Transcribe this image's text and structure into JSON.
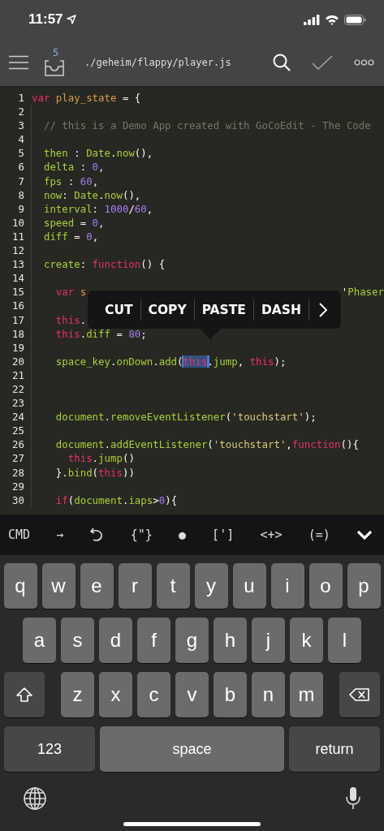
{
  "status_bar": {
    "time": "11:57"
  },
  "header": {
    "badge": "5",
    "path": "./geheim/flappy/player.js"
  },
  "code": {
    "lines": [
      {
        "n": "1",
        "tokens": [
          {
            "t": "var ",
            "kind": "kw"
          },
          {
            "t": "play_state",
            "kind": "name"
          },
          {
            "t": " = {",
            "kind": "punct"
          }
        ]
      },
      {
        "n": "2"
      },
      {
        "n": "3",
        "tokens": [
          {
            "t": "  // this is a Demo App created with GoCoEdit - The Code",
            "kind": "cmt"
          }
        ]
      },
      {
        "n": "4"
      },
      {
        "n": "5",
        "tokens": [
          {
            "t": "  then",
            "kind": "prop"
          },
          {
            "t": " : ",
            "kind": "punct"
          },
          {
            "t": "Date",
            "kind": "prop"
          },
          {
            "t": ".",
            "kind": "punct"
          },
          {
            "t": "now",
            "kind": "prop"
          },
          {
            "t": "(),",
            "kind": "punct"
          }
        ]
      },
      {
        "n": "6",
        "tokens": [
          {
            "t": "  delta",
            "kind": "prop"
          },
          {
            "t": " : ",
            "kind": "punct"
          },
          {
            "t": "0",
            "kind": "num"
          },
          {
            "t": ",",
            "kind": "punct"
          }
        ]
      },
      {
        "n": "7",
        "tokens": [
          {
            "t": "  fps",
            "kind": "prop"
          },
          {
            "t": " : ",
            "kind": "punct"
          },
          {
            "t": "60",
            "kind": "num"
          },
          {
            "t": ",",
            "kind": "punct"
          }
        ]
      },
      {
        "n": "8",
        "tokens": [
          {
            "t": "  now",
            "kind": "prop"
          },
          {
            "t": ": ",
            "kind": "punct"
          },
          {
            "t": "Date",
            "kind": "prop"
          },
          {
            "t": ".",
            "kind": "punct"
          },
          {
            "t": "now",
            "kind": "prop"
          },
          {
            "t": "(),",
            "kind": "punct"
          }
        ]
      },
      {
        "n": "9",
        "tokens": [
          {
            "t": "  interval",
            "kind": "prop"
          },
          {
            "t": ": ",
            "kind": "punct"
          },
          {
            "t": "1000",
            "kind": "num"
          },
          {
            "t": "/",
            "kind": "punct"
          },
          {
            "t": "60",
            "kind": "num"
          },
          {
            "t": ",",
            "kind": "punct"
          }
        ]
      },
      {
        "n": "10",
        "tokens": [
          {
            "t": "  speed",
            "kind": "prop"
          },
          {
            "t": " = ",
            "kind": "punct"
          },
          {
            "t": "0",
            "kind": "num"
          },
          {
            "t": ",",
            "kind": "punct"
          }
        ]
      },
      {
        "n": "11",
        "tokens": [
          {
            "t": "  diff",
            "kind": "prop"
          },
          {
            "t": " = ",
            "kind": "punct"
          },
          {
            "t": "0",
            "kind": "num"
          },
          {
            "t": ",",
            "kind": "punct"
          }
        ]
      },
      {
        "n": "12"
      },
      {
        "n": "13",
        "tokens": [
          {
            "t": "  create",
            "kind": "prop"
          },
          {
            "t": ": ",
            "kind": "punct"
          },
          {
            "t": "function",
            "kind": "kw"
          },
          {
            "t": "() {",
            "kind": "punct"
          }
        ]
      },
      {
        "n": "14"
      },
      {
        "n": "15",
        "tokens": [
          {
            "t": "    var ",
            "kind": "kw"
          },
          {
            "t": "s",
            "kind": "name"
          }
        ],
        "tail": [
          {
            "t": "'",
            "kind": "punct"
          },
          {
            "t": "Phaser",
            "kind": "prop"
          }
        ]
      },
      {
        "n": "16"
      },
      {
        "n": "17",
        "tokens": [
          {
            "t": "    this",
            "kind": "kw"
          },
          {
            "t": ".",
            "kind": "punct"
          }
        ]
      },
      {
        "n": "18",
        "tokens": [
          {
            "t": "    this",
            "kind": "kw"
          },
          {
            "t": ".",
            "kind": "punct"
          },
          {
            "t": "diff",
            "kind": "prop"
          },
          {
            "t": " = ",
            "kind": "punct"
          },
          {
            "t": "80",
            "kind": "num"
          },
          {
            "t": ";",
            "kind": "punct"
          }
        ]
      },
      {
        "n": "19"
      },
      {
        "n": "20",
        "tokens": [
          {
            "t": "    space_key",
            "kind": "prop"
          },
          {
            "t": ".",
            "kind": "punct"
          },
          {
            "t": "onDown",
            "kind": "prop"
          },
          {
            "t": ".",
            "kind": "punct"
          },
          {
            "t": "add",
            "kind": "prop"
          },
          {
            "t": "(",
            "kind": "punct"
          },
          {
            "t": "this",
            "kind": "kw",
            "selected": true
          },
          {
            "t": ".",
            "kind": "punct"
          },
          {
            "t": "jump",
            "kind": "prop"
          },
          {
            "t": ", ",
            "kind": "punct"
          },
          {
            "t": "this",
            "kind": "kw"
          },
          {
            "t": ");",
            "kind": "punct"
          }
        ]
      },
      {
        "n": "21"
      },
      {
        "n": "22"
      },
      {
        "n": "23"
      },
      {
        "n": "24",
        "tokens": [
          {
            "t": "    document",
            "kind": "prop"
          },
          {
            "t": ".",
            "kind": "punct"
          },
          {
            "t": "removeEventListener",
            "kind": "prop"
          },
          {
            "t": "(",
            "kind": "punct"
          },
          {
            "t": "'touchstart'",
            "kind": "str"
          },
          {
            "t": ");",
            "kind": "punct"
          }
        ]
      },
      {
        "n": "25"
      },
      {
        "n": "26",
        "tokens": [
          {
            "t": "    document",
            "kind": "prop"
          },
          {
            "t": ".",
            "kind": "punct"
          },
          {
            "t": "addEventListener",
            "kind": "prop"
          },
          {
            "t": "(",
            "kind": "punct"
          },
          {
            "t": "'touchstart'",
            "kind": "str"
          },
          {
            "t": ",",
            "kind": "punct"
          },
          {
            "t": "function",
            "kind": "kw"
          },
          {
            "t": "(){",
            "kind": "punct"
          }
        ]
      },
      {
        "n": "27",
        "tokens": [
          {
            "t": "      this",
            "kind": "kw"
          },
          {
            "t": ".",
            "kind": "punct"
          },
          {
            "t": "jump",
            "kind": "prop"
          },
          {
            "t": "()",
            "kind": "punct"
          }
        ]
      },
      {
        "n": "28",
        "tokens": [
          {
            "t": "    }.",
            "kind": "punct"
          },
          {
            "t": "bind",
            "kind": "prop"
          },
          {
            "t": "(",
            "kind": "punct"
          },
          {
            "t": "this",
            "kind": "kw"
          },
          {
            "t": "))",
            "kind": "punct"
          }
        ]
      },
      {
        "n": "29"
      },
      {
        "n": "30",
        "tokens": [
          {
            "t": "    if",
            "kind": "kw"
          },
          {
            "t": "(",
            "kind": "punct"
          },
          {
            "t": "document",
            "kind": "prop"
          },
          {
            "t": ".",
            "kind": "punct"
          },
          {
            "t": "iaps",
            "kind": "prop"
          },
          {
            "t": ">",
            "kind": "punct"
          },
          {
            "t": "0",
            "kind": "num"
          },
          {
            "t": "){",
            "kind": "punct"
          }
        ]
      }
    ]
  },
  "edit_menu": {
    "items": [
      "CUT",
      "COPY",
      "PASTE",
      "DASH"
    ]
  },
  "accessory_bar": {
    "items": [
      {
        "kind": "text",
        "label": "CMD"
      },
      {
        "kind": "text",
        "label": "→"
      },
      {
        "kind": "undo"
      },
      {
        "kind": "text",
        "label": "{\"}"
      },
      {
        "kind": "text",
        "label": "●"
      },
      {
        "kind": "text",
        "label": "[']"
      },
      {
        "kind": "text",
        "label": "<+>"
      },
      {
        "kind": "text",
        "label": "(=)"
      },
      {
        "kind": "hide"
      }
    ]
  },
  "keyboard": {
    "rows": [
      {
        "keys": [
          {
            "kind": "letter",
            "label": "q"
          },
          {
            "kind": "letter",
            "label": "w"
          },
          {
            "kind": "letter",
            "label": "e"
          },
          {
            "kind": "letter",
            "label": "r"
          },
          {
            "kind": "letter",
            "label": "t"
          },
          {
            "kind": "letter",
            "label": "y"
          },
          {
            "kind": "letter",
            "label": "u"
          },
          {
            "kind": "letter",
            "label": "i"
          },
          {
            "kind": "letter",
            "label": "o"
          },
          {
            "kind": "letter",
            "label": "p"
          }
        ]
      },
      {
        "keys": [
          {
            "kind": "letter",
            "label": "a"
          },
          {
            "kind": "letter",
            "label": "s"
          },
          {
            "kind": "letter",
            "label": "d"
          },
          {
            "kind": "letter",
            "label": "f"
          },
          {
            "kind": "letter",
            "label": "g"
          },
          {
            "kind": "letter",
            "label": "h"
          },
          {
            "kind": "letter",
            "label": "j"
          },
          {
            "kind": "letter",
            "label": "k"
          },
          {
            "kind": "letter",
            "label": "l"
          }
        ]
      },
      {
        "keys": [
          {
            "kind": "shift"
          },
          {
            "kind": "letter",
            "label": "z"
          },
          {
            "kind": "letter",
            "label": "x"
          },
          {
            "kind": "letter",
            "label": "c"
          },
          {
            "kind": "letter",
            "label": "v"
          },
          {
            "kind": "letter",
            "label": "b"
          },
          {
            "kind": "letter",
            "label": "n"
          },
          {
            "kind": "letter",
            "label": "m"
          },
          {
            "kind": "backspace"
          }
        ]
      },
      {
        "keys": [
          {
            "kind": "numbers",
            "label": "123"
          },
          {
            "kind": "space",
            "label": "space"
          },
          {
            "kind": "return",
            "label": "return"
          }
        ]
      }
    ]
  }
}
